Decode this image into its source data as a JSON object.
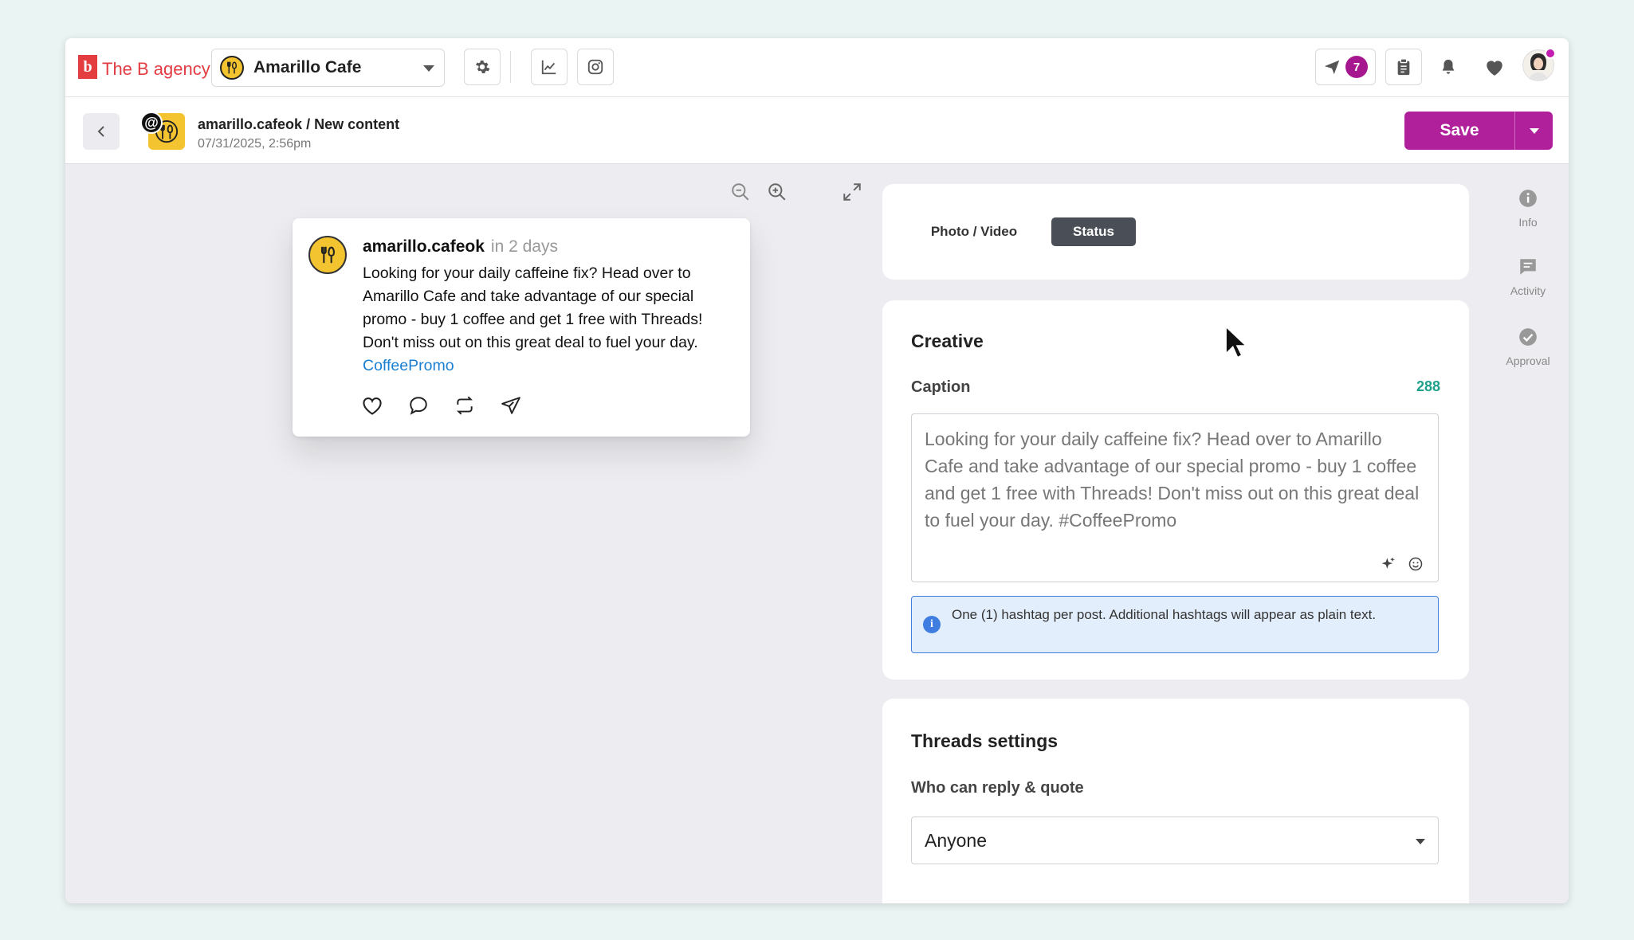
{
  "brand": {
    "logo_letter": "b",
    "name": "The B agency",
    "color": "#e23c42"
  },
  "account": {
    "name": "Amarillo Cafe"
  },
  "notifications": {
    "outbox_count": "7"
  },
  "post_header": {
    "breadcrumb": "amarillo.cafeok / New content",
    "timestamp": "07/31/2025, 2:56pm",
    "network_badge": "@"
  },
  "actions": {
    "save_label": "Save",
    "accent": "#b0209a"
  },
  "preview": {
    "username": "amarillo.cafeok",
    "time": "in 2 days",
    "text": "Looking for your daily caffeine fix? Head over to Amarillo Cafe and take advantage of our special promo - buy 1 coffee and get 1 free with Threads! Don't miss out on this great deal to fuel your day. ",
    "link": "CoffeePromo"
  },
  "tabs": [
    {
      "label": "Photo / Video",
      "active": false
    },
    {
      "label": "Status",
      "active": true
    }
  ],
  "creative": {
    "title": "Creative",
    "caption_label": "Caption",
    "char_count": "288",
    "caption_value": "Looking for your daily caffeine fix? Head over to Amarillo Cafe and take advantage of our special promo - buy 1 coffee and get 1 free with Threads! Don't miss out on this great deal to fuel your day. #CoffeePromo",
    "info_icon": "i",
    "info_text": "One (1) hashtag per post. Additional hashtags will appear as plain text."
  },
  "threads_settings": {
    "title": "Threads settings",
    "reply_label": "Who can reply & quote",
    "reply_value": "Anyone"
  },
  "rail": [
    {
      "label": "Info",
      "icon": "info-icon"
    },
    {
      "label": "Activity",
      "icon": "chat-icon"
    },
    {
      "label": "Approval",
      "icon": "check-circle-icon"
    }
  ]
}
